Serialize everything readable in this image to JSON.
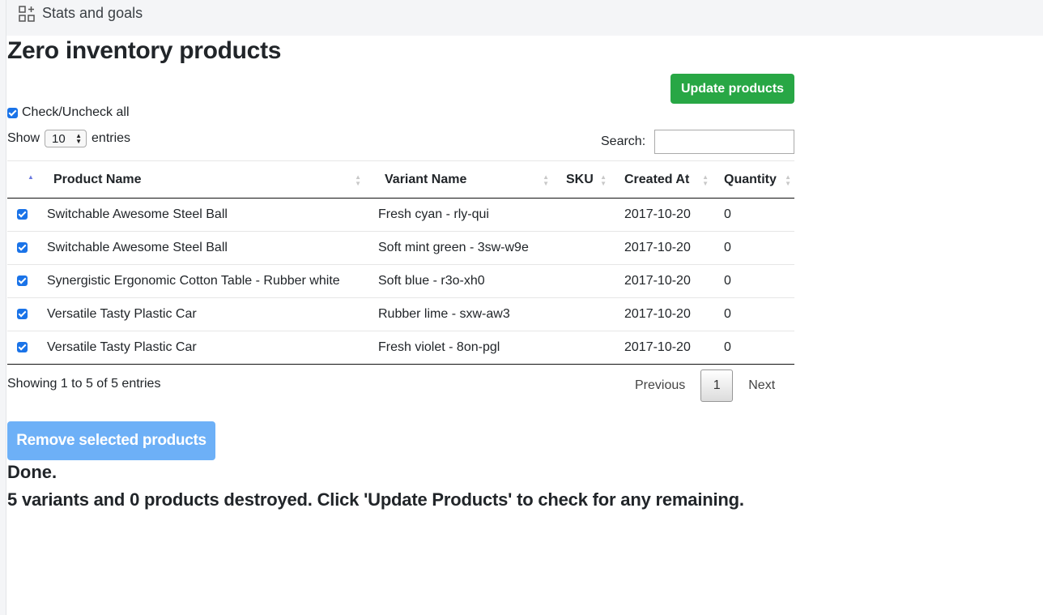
{
  "topbar": {
    "icon": "grid-add-icon",
    "title": "Stats and goals"
  },
  "page": {
    "title": "Zero inventory products"
  },
  "actions": {
    "update_label": "Update products",
    "remove_label": "Remove selected products"
  },
  "check_all": {
    "label": "Check/Uncheck all",
    "checked": true
  },
  "length": {
    "show": "Show",
    "value": "10",
    "entries": "entries"
  },
  "search": {
    "label": "Search:",
    "value": ""
  },
  "table": {
    "columns": [
      "Product Name",
      "Variant Name",
      "SKU",
      "Created At",
      "Quantity"
    ],
    "rows": [
      {
        "checked": true,
        "product": "Switchable Awesome Steel Ball",
        "variant": "Fresh cyan - rly-qui",
        "sku": "",
        "created": "2017-10-20",
        "quantity": "0"
      },
      {
        "checked": true,
        "product": "Switchable Awesome Steel Ball",
        "variant": "Soft mint green - 3sw-w9e",
        "sku": "",
        "created": "2017-10-20",
        "quantity": "0"
      },
      {
        "checked": true,
        "product": "Synergistic Ergonomic Cotton Table - Rubber white",
        "variant": "Soft blue - r3o-xh0",
        "sku": "",
        "created": "2017-10-20",
        "quantity": "0"
      },
      {
        "checked": true,
        "product": "Versatile Tasty Plastic Car",
        "variant": "Rubber lime - sxw-aw3",
        "sku": "",
        "created": "2017-10-20",
        "quantity": "0"
      },
      {
        "checked": true,
        "product": "Versatile Tasty Plastic Car",
        "variant": "Fresh violet - 8on-pgl",
        "sku": "",
        "created": "2017-10-20",
        "quantity": "0"
      }
    ]
  },
  "footer": {
    "info": "Showing 1 to 5 of 5 entries",
    "previous": "Previous",
    "page": "1",
    "next": "Next"
  },
  "status": {
    "done": "Done.",
    "message": "5 variants and 0 products destroyed. Click 'Update Products' to check for any remaining."
  },
  "colors": {
    "update_button": "#28a745",
    "remove_button": "#6db0f7",
    "checkbox": "#1a73e8"
  }
}
